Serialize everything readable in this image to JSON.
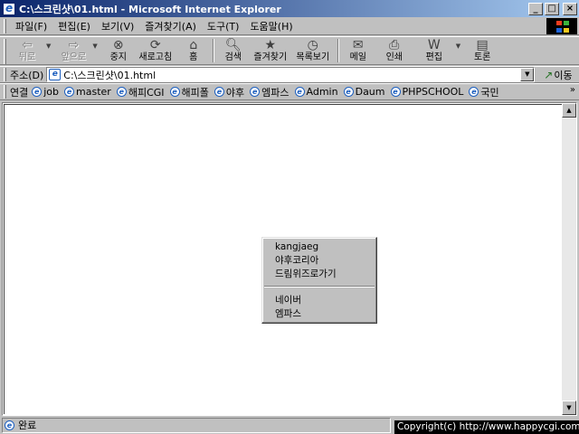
{
  "window": {
    "title": "C:\\스크린샷\\01.html - Microsoft Internet Explorer",
    "minimize": "_",
    "maximize": "□",
    "close": "×"
  },
  "menu": [
    "파일(F)",
    "편집(E)",
    "보기(V)",
    "즐겨찾기(A)",
    "도구(T)",
    "도움말(H)"
  ],
  "toolbar": {
    "back": "뒤로",
    "forward": "앞으로",
    "stop": "중지",
    "refresh": "새로고침",
    "home": "홈",
    "search": "검색",
    "favorites": "즐겨찾기",
    "history": "목록보기",
    "mail": "메일",
    "print": "인쇄",
    "edit": "편집",
    "discuss": "토론"
  },
  "address": {
    "label": "주소(D)",
    "value": "C:\\스크린샷\\01.html",
    "go": "이동"
  },
  "links": {
    "label": "연결",
    "items": [
      "job",
      "master",
      "해피CGI",
      "해피폴",
      "야후",
      "엠파스",
      "Admin",
      "Daum",
      "PHPSCHOOL",
      "국민"
    ],
    "more": "»"
  },
  "popup": {
    "group1": [
      "kangjaeg",
      "야후코리아",
      "드림위즈로가기"
    ],
    "group2": [
      "네이버",
      "엠파스"
    ]
  },
  "status": {
    "text": "완료"
  },
  "copyright": "Copyright(c) http://www.happycgi.com"
}
